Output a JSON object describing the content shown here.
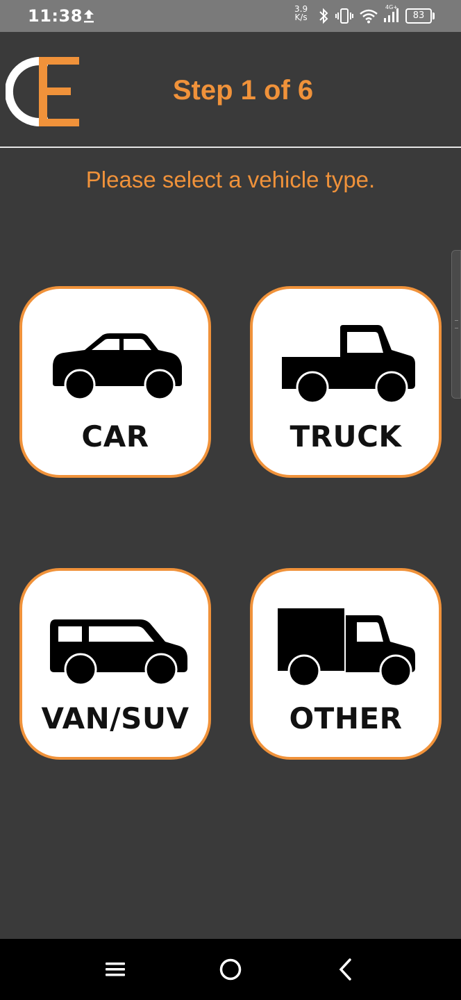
{
  "status_bar": {
    "time": "11:38",
    "speed_value": "3.9",
    "speed_unit": "K/s",
    "network_label": "4G+",
    "battery": "83",
    "icons": [
      "upload-icon",
      "bluetooth-icon",
      "vibrate-icon",
      "wifi-icon",
      "signal-icon",
      "battery-icon"
    ]
  },
  "header": {
    "logo_name": "ce-logo",
    "step_title": "Step 1 of 6"
  },
  "prompt": "Please select a vehicle type.",
  "vehicles": [
    {
      "label": "CAR",
      "icon": "car-icon"
    },
    {
      "label": "TRUCK",
      "icon": "pickup-truck-icon"
    },
    {
      "label": "VAN/SUV",
      "icon": "van-suv-icon"
    },
    {
      "label": "OTHER",
      "icon": "box-truck-icon"
    }
  ],
  "nav_bar": {
    "icons": [
      "menu-icon",
      "home-icon",
      "back-icon"
    ]
  },
  "colors": {
    "accent": "#f0923a",
    "background": "#3a3a3a",
    "tile": "#ffffff",
    "text_dark": "#111111"
  }
}
